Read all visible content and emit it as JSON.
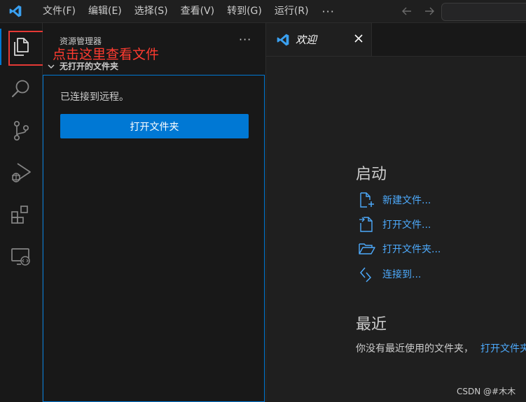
{
  "menu": [
    "文件(F)",
    "编辑(E)",
    "选择(S)",
    "查看(V)",
    "转到(G)",
    "运行(R)"
  ],
  "menu_more": "···",
  "annotation": "点击这里查看文件",
  "sidebar": {
    "title": "资源管理器",
    "more": "···",
    "section": "无打开的文件夹",
    "connected": "已连接到远程。",
    "open_folder": "打开文件夹"
  },
  "editor": {
    "tab_label": "欢迎",
    "start_heading": "启动",
    "links": {
      "new_file": "新建文件...",
      "open_file": "打开文件...",
      "open_folder": "打开文件夹...",
      "connect": "连接到..."
    },
    "recent_heading": "最近",
    "recent_text": "你没有最近使用的文件夹，",
    "recent_link": "打开文件夹"
  },
  "watermark": "CSDN @#木木",
  "colors": {
    "accent": "#0078d4",
    "link": "#4daafc",
    "annotation": "#ff3b30"
  }
}
